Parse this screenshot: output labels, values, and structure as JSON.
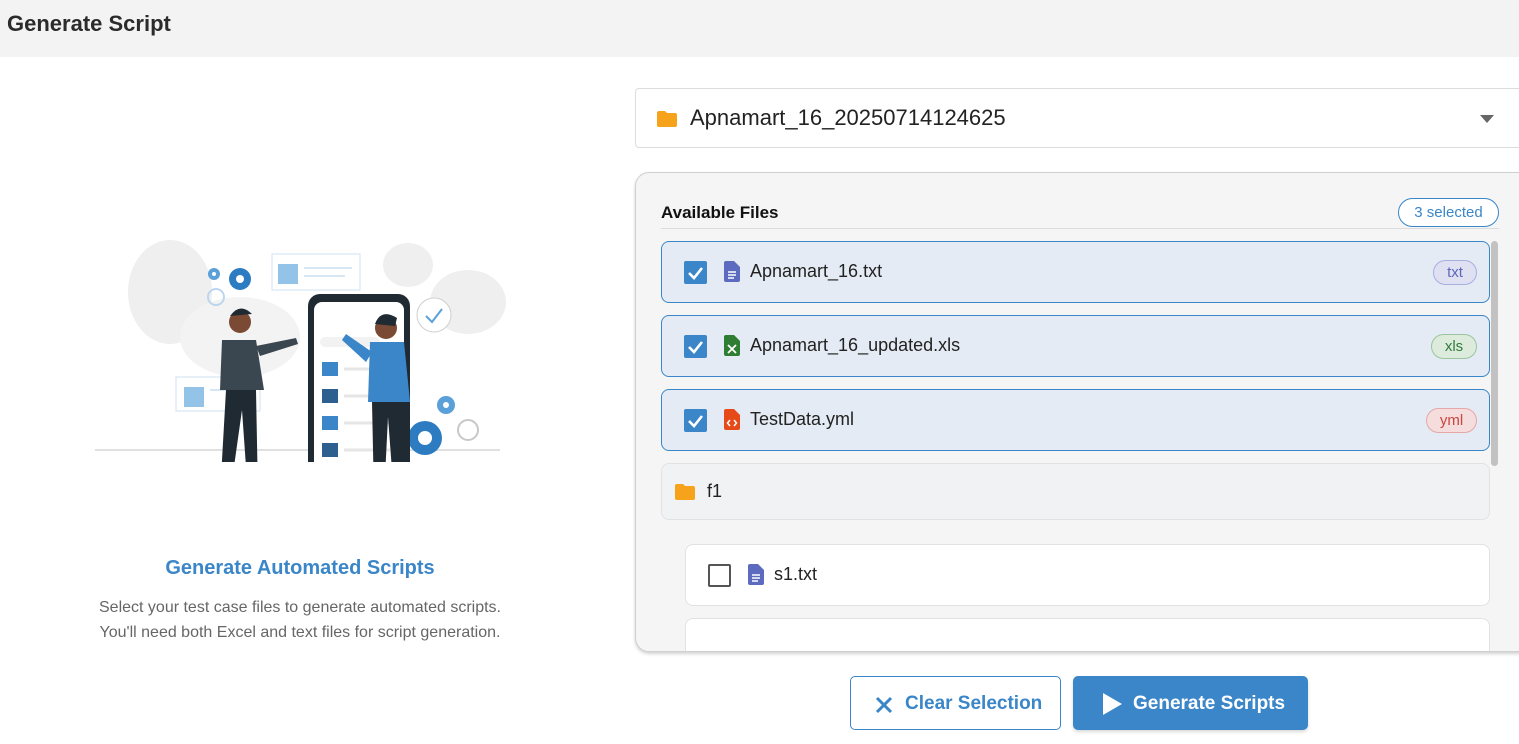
{
  "header": {
    "title": "Generate Script"
  },
  "intro": {
    "heading": "Generate Automated Scripts",
    "line1": "Select your test case files to generate automated scripts.",
    "line2": "You'll need both Excel and text files for script generation."
  },
  "folder_select": {
    "selected": "Apnamart_16_20250714124625",
    "icon": "folder-icon"
  },
  "files_panel": {
    "title": "Available Files",
    "selected_badge": "3 selected",
    "files": [
      {
        "name": "Apnamart_16.txt",
        "ext": "txt",
        "checked": true,
        "icon": "text-file-icon"
      },
      {
        "name": "Apnamart_16_updated.xls",
        "ext": "xls",
        "checked": true,
        "icon": "excel-file-icon"
      },
      {
        "name": "TestData.yml",
        "ext": "yml",
        "checked": true,
        "icon": "code-file-icon"
      }
    ],
    "folder": {
      "name": "f1",
      "icon": "folder-icon"
    },
    "sub_files": [
      {
        "name": "s1.txt",
        "checked": false,
        "icon": "text-file-icon"
      }
    ]
  },
  "actions": {
    "clear_label": "Clear Selection",
    "generate_label": "Generate Scripts"
  },
  "colors": {
    "accent": "#3a86c8",
    "folder": "#f6a21a",
    "txt": "#5c6bc0",
    "xls": "#2e7d32",
    "yml": "#e64a19"
  }
}
